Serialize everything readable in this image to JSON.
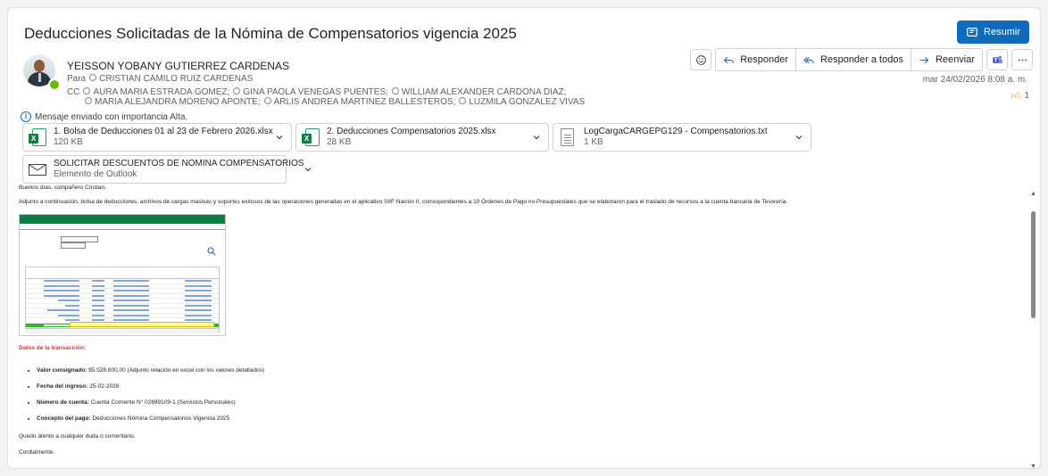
{
  "subject": "Deducciones Solicitadas de la Nómina de Compensatorios vigencia 2025",
  "summarize_label": "Resumir",
  "actions": {
    "reply": "Responder",
    "reply_all": "Responder a todos",
    "forward": "Reenviar"
  },
  "sender": {
    "name": "YEISSON YOBANY GUTIERREZ CARDENAS",
    "presence": "available"
  },
  "to_label": "Para",
  "to": [
    "CRISTIAN CAMILO RUIZ CARDENAS"
  ],
  "cc_label": "CC",
  "cc": [
    "AURA MARIA ESTRADA GOMEZ;",
    "GINA PAOLA VENEGAS PUENTES;",
    "WILLIAM ALEXANDER CARDONA DIAZ;",
    "MARIA ALEJANDRA MORENO APONTE;",
    "ARLIS ANDREA MARTINEZ BALLESTEROS;",
    "LUZMILA GONZALEZ VIVAS"
  ],
  "date": "mar 24/02/2026 8:08 a. m.",
  "reaction": {
    "icon": "thumbs-up-icon",
    "count": "1"
  },
  "importance_note": "Mensaje enviado con importancia Alta.",
  "attachments": [
    {
      "name": "1. Bolsa de Deducciones 01 al 23 de Febrero 2026.xlsx",
      "size": "120 KB",
      "type": "excel"
    },
    {
      "name": "2. Deducciones Compensatorios 2025.xlsx",
      "size": "28 KB",
      "type": "excel"
    },
    {
      "name": "LogCargaCARGEPG129 - Compensatorios.txt",
      "size": "1 KB",
      "type": "text"
    },
    {
      "name": "SOLICITAR DESCUENTOS DE NOMINA COMPENSATORIOS",
      "size": "Elemento de Outlook",
      "type": "outlook-item"
    }
  ],
  "body": {
    "greeting": "Buenos días, compañero Cristian.",
    "intro": "Adjunto a continuación, bolsa de deducciones, archivos de cargas masivas y soportes exitosos de las operaciones generadas en el aplicativo SIIF Nación II, correspondientes a 10 Órdenes de Pago no Presupuestales que se elaboraron para el traslado de recursos a la cuenta bancaria de Tesorería.",
    "section_title": "Datos de la transacción:",
    "details": [
      {
        "label": "Valor consignado:",
        "value": "$5.528.600,00 (Adjunto relación en excel con los valores detallados)"
      },
      {
        "label": "Fecha del ingreso:",
        "value": "25-02-2026"
      },
      {
        "label": "Número de cuenta:",
        "value": "Cuenta Corriente N° 02699109-1 (Servicios Personales)"
      },
      {
        "label": "Concepto del pago:",
        "value": "Deducciones Nómina Compensatorios Vigencia 2025"
      }
    ],
    "closing": "Quedo atento a cualquier duda o comentario.",
    "signoff": "Cordialmente."
  },
  "colors": {
    "accent": "#0f6cbd",
    "excel": "#107c41",
    "section_title": "#d13438",
    "highlight_row": "#2eb82e"
  }
}
